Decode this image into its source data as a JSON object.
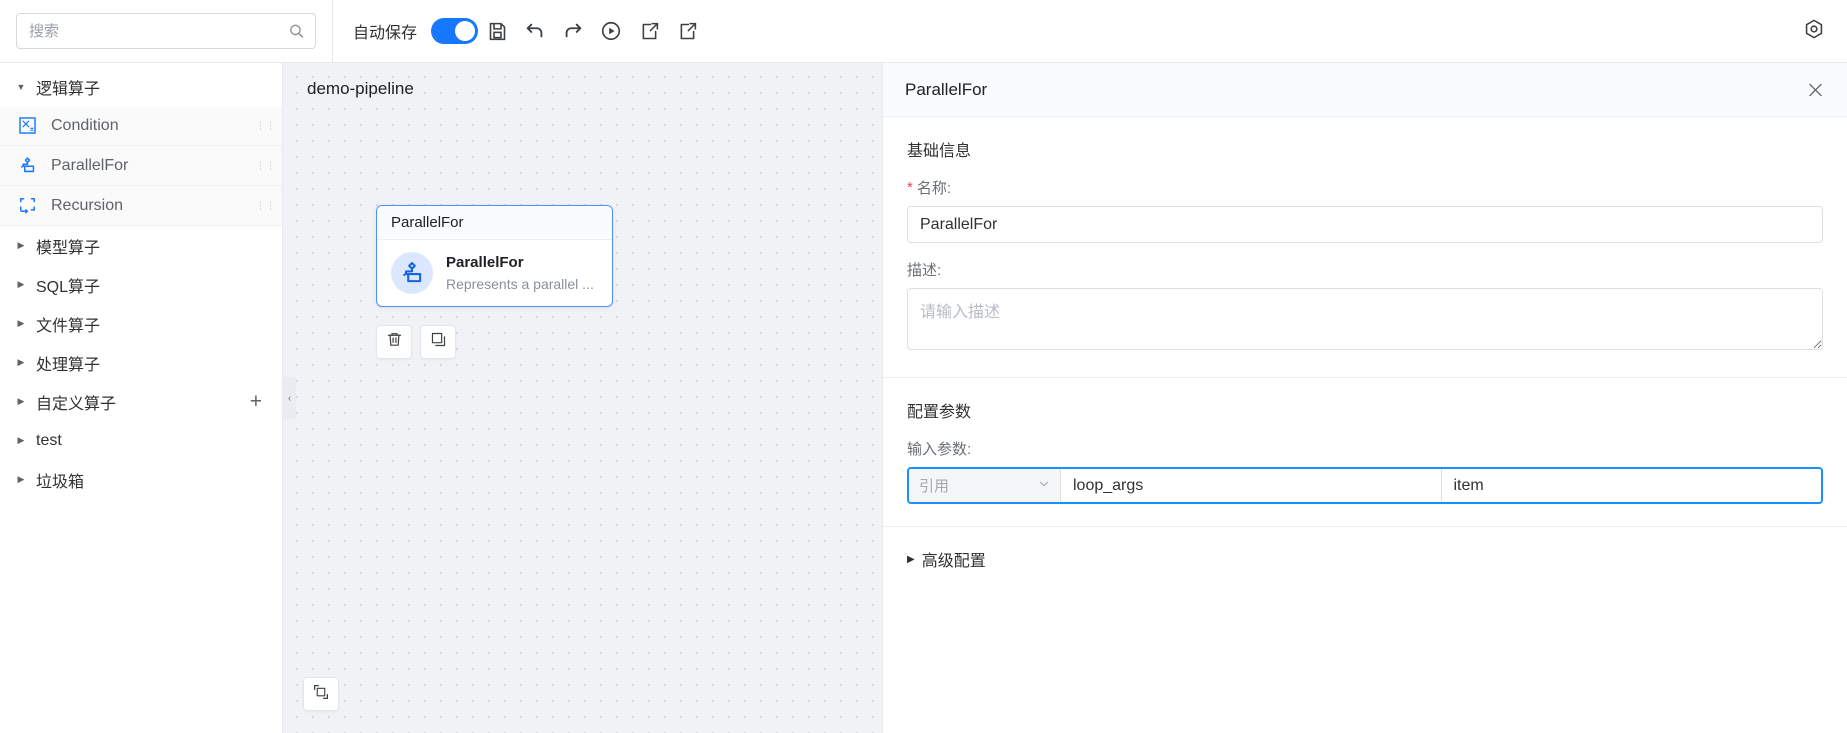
{
  "search": {
    "placeholder": "搜索",
    "value": "",
    "icon": "search-icon"
  },
  "toolbar": {
    "autosave_label": "自动保存",
    "autosave_on": true,
    "buttons": [
      {
        "name": "save-button",
        "icon": "floppy-disk-icon"
      },
      {
        "name": "undo-button",
        "icon": "undo-arrow-icon"
      },
      {
        "name": "redo-button",
        "icon": "redo-arrow-icon"
      },
      {
        "name": "run-button",
        "icon": "play-circle-icon"
      },
      {
        "name": "export-button",
        "icon": "export-file-icon"
      },
      {
        "name": "import-button",
        "icon": "import-file-icon"
      }
    ],
    "settings_icon": "hexagon-settings-icon"
  },
  "sidebar": {
    "groups": [
      {
        "label": "逻辑算子",
        "expanded": true,
        "has_add": false,
        "items": [
          {
            "label": "Condition",
            "icon": "condition-icon"
          },
          {
            "label": "ParallelFor",
            "icon": "parallel-for-icon"
          },
          {
            "label": "Recursion",
            "icon": "recursion-icon"
          }
        ]
      },
      {
        "label": "模型算子",
        "expanded": false,
        "has_add": false,
        "items": []
      },
      {
        "label": "SQL算子",
        "expanded": false,
        "has_add": false,
        "items": []
      },
      {
        "label": "文件算子",
        "expanded": false,
        "has_add": false,
        "items": []
      },
      {
        "label": "处理算子",
        "expanded": false,
        "has_add": false,
        "items": []
      },
      {
        "label": "自定义算子",
        "expanded": false,
        "has_add": true,
        "items": []
      },
      {
        "label": "test",
        "expanded": false,
        "has_add": false,
        "items": []
      },
      {
        "label": "垃圾箱",
        "expanded": false,
        "has_add": false,
        "items": []
      }
    ],
    "expand_caret": "▼",
    "collapse_caret": "▶",
    "add_label": "+",
    "drag_handle": "⋮⋮"
  },
  "canvas": {
    "pipeline_name": "demo-pipeline",
    "node": {
      "header": "ParallelFor",
      "title": "ParallelFor",
      "description": "Represents a parallel ...",
      "icon": "parallel-for-icon"
    },
    "node_tools": [
      {
        "name": "delete-node-button",
        "icon": "trash-icon"
      },
      {
        "name": "copy-node-button",
        "icon": "copy-icon"
      }
    ],
    "fit_button": {
      "name": "fit-view-button",
      "icon": "fit-screen-icon"
    },
    "collapse_handle": "‹"
  },
  "panel": {
    "title": "ParallelFor",
    "close_icon": "close-icon",
    "basic_section": {
      "title": "基础信息",
      "name_label": "名称:",
      "name_required": "*",
      "name_value": "ParallelFor",
      "desc_label": "描述:",
      "desc_value": "",
      "desc_placeholder": "请输入描述"
    },
    "config_section": {
      "title": "配置参数",
      "input_params_label": "输入参数:",
      "rows": [
        {
          "type": "引用",
          "key": "loop_args",
          "value": "item"
        }
      ],
      "select_caret": "⌄"
    },
    "advanced": {
      "label": "高级配置",
      "caret": "▶",
      "expanded": false
    }
  },
  "colors": {
    "accent": "#1677ff",
    "focus_border": "#1890ff",
    "required_star": "#e34d4d",
    "canvas_bg": "#f0f2f5",
    "node_border": "#4a90ff"
  }
}
